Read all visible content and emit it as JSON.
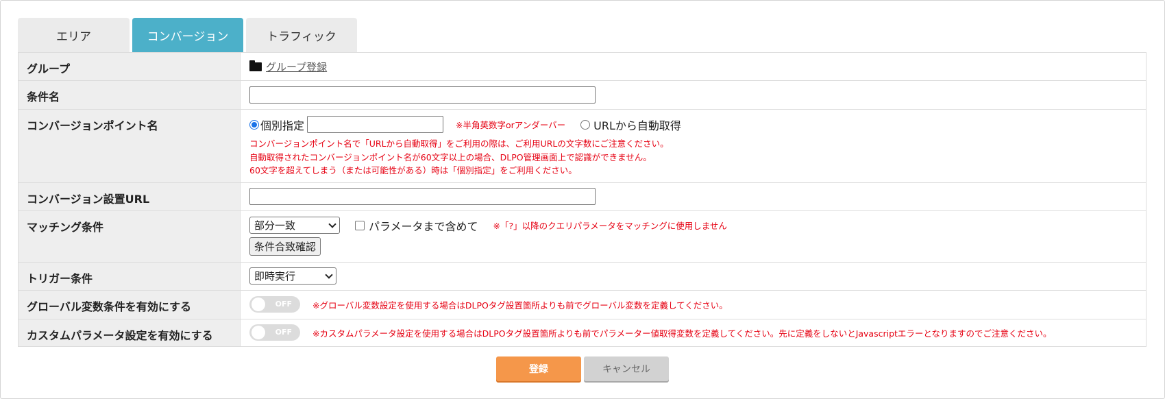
{
  "tabs": [
    {
      "label": "エリア"
    },
    {
      "label": "コンバージョン"
    },
    {
      "label": "トラフィック"
    }
  ],
  "form": {
    "group": {
      "label": "グループ",
      "link": "グループ登録"
    },
    "condition_name": {
      "label": "条件名",
      "value": ""
    },
    "conversion_point": {
      "label": "コンバージョンポイント名",
      "radio_individual": "個別指定",
      "input_value": "",
      "hint": "※半角英数字orアンダーバー",
      "radio_auto": "URLから自動取得",
      "notes": [
        "コンバージョンポイント名で「URLから自動取得」をご利用の際は、ご利用URLの文字数にご注意ください。",
        "自動取得されたコンバージョンポイント名が60文字以上の場合、DLPO管理画面上で認識ができません。",
        "60文字を超えてしまう（または可能性がある）時は「個別指定」をご利用ください。"
      ]
    },
    "conversion_url": {
      "label": "コンバージョン設置URL",
      "value": ""
    },
    "matching": {
      "label": "マッチング条件",
      "select_value": "部分一致",
      "checkbox_label": "パラメータまで含めて",
      "note": "※「?」以降のクエリパラメータをマッチングに使用しません",
      "confirm_button": "条件合致確認"
    },
    "trigger": {
      "label": "トリガー条件",
      "select_value": "即時実行"
    },
    "global_var": {
      "label": "グローバル変数条件を有効にする",
      "toggle": "OFF",
      "note": "※グローバル変数設定を使用する場合はDLPOタグ設置箇所よりも前でグローバル変数を定義してください。"
    },
    "custom_param": {
      "label": "カスタムパラメータ設定を有効にする",
      "toggle": "OFF",
      "note": "※カスタムパラメータ設定を使用する場合はDLPOタグ設置箇所よりも前でパラメーター値取得変数を定義してください。先に定義をしないとJavascriptエラーとなりますのでご注意ください。"
    }
  },
  "buttons": {
    "submit": "登録",
    "cancel": "キャンセル"
  },
  "colors": {
    "tab_active": "#4cb0c9",
    "submit": "#f5974a",
    "cancel": "#d2d2d2",
    "note_red": "#e60012"
  }
}
